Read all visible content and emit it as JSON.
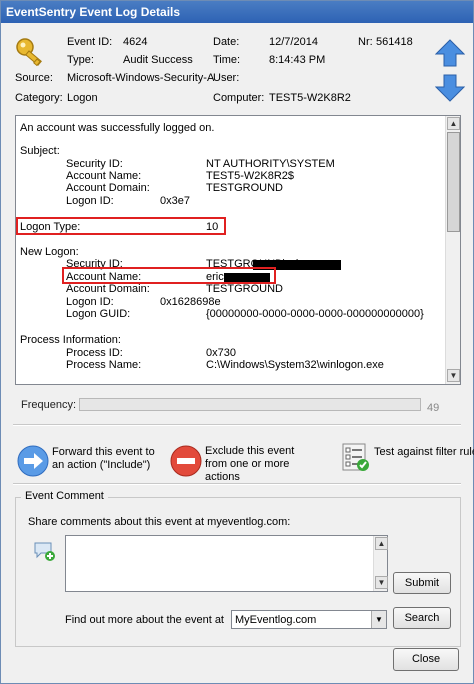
{
  "window": {
    "title": "EventSentry Event Log Details"
  },
  "header": {
    "event_id_label": "Event ID:",
    "event_id": "4624",
    "date_label": "Date:",
    "date": "12/7/2014",
    "nr_label": "Nr:",
    "nr": "561418",
    "type_label": "Type:",
    "type": "Audit Success",
    "time_label": "Time:",
    "time": "8:14:43 PM",
    "source_label": "Source:",
    "source": "Microsoft-Windows-Security-A",
    "user_label": "User:",
    "user": "",
    "category_label": "Category:",
    "category": "Logon",
    "computer_label": "Computer:",
    "computer": "TEST5-W2K8R2"
  },
  "nav": {
    "prev_icon": "arrow-up-icon",
    "next_icon": "arrow-down-icon"
  },
  "description": {
    "line1": "An account was successfully logged on.",
    "subject_header": "Subject:",
    "subject_security_id_label": "Security ID:",
    "subject_security_id": "NT AUTHORITY\\SYSTEM",
    "subject_account_name_label": "Account Name:",
    "subject_account_name": "TEST5-W2K8R2$",
    "subject_account_domain_label": "Account Domain:",
    "subject_account_domain": "TESTGROUND",
    "subject_logon_id_label": "Logon ID:",
    "subject_logon_id": "0x3e7",
    "logon_type_label": "Logon Type:",
    "logon_type": "10",
    "new_logon_header": "New Logon:",
    "new_security_id_label": "Security ID:",
    "new_security_id": "TESTGROUND\\eric",
    "new_account_name_label": "Account Name:",
    "new_account_name": "eric",
    "new_account_domain_label": "Account Domain:",
    "new_account_domain": "TESTGROUND",
    "new_logon_id_label": "Logon ID:",
    "new_logon_id": "0x1628698e",
    "new_logon_guid_label": "Logon GUID:",
    "new_logon_guid": "{00000000-0000-0000-0000-000000000000}",
    "process_header": "Process Information:",
    "process_id_label": "Process ID:",
    "process_id": "0x730",
    "process_name_label": "Process Name:",
    "process_name": "C:\\Windows\\System32\\winlogon.exe"
  },
  "frequency": {
    "label": "Frequency:",
    "value": "49"
  },
  "actions": {
    "forward_label": "Forward this event to an action (\"Include\")",
    "exclude_label": "Exclude this event from one or more actions",
    "test_label": "Test against filter rules"
  },
  "comment": {
    "group_title": "Event Comment",
    "share_label": "Share comments about this event at myeventlog.com:",
    "text": "",
    "submit_label": "Submit",
    "find_label": "Find out more about the event at",
    "site_selected": "MyEventlog.com",
    "search_label": "Search"
  },
  "footer": {
    "close_label": "Close"
  },
  "colors": {
    "titlebar": "#2d62b4",
    "highlight": "#e02020",
    "nav_arrow": "#3d7fd8"
  }
}
